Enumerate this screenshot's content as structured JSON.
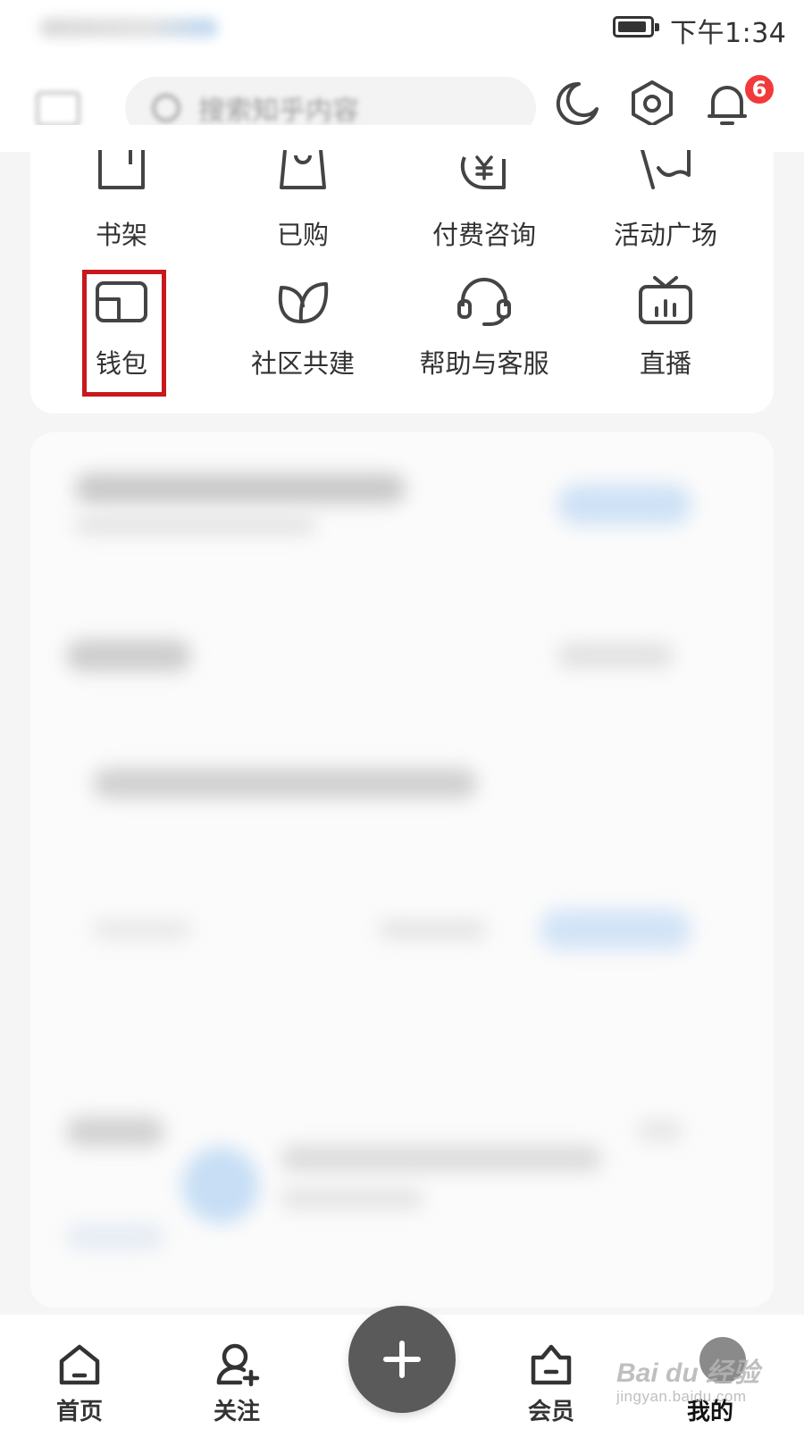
{
  "status_bar": {
    "time": "下午1:34"
  },
  "header": {
    "search_placeholder": "搜索知乎内容",
    "notification_count": "6"
  },
  "services": {
    "row1": [
      "书架",
      "已购",
      "付费咨询",
      "活动广场"
    ],
    "row2": [
      "钱包",
      "社区共建",
      "帮助与客服",
      "直播"
    ]
  },
  "bottom_nav": {
    "items": [
      "首页",
      "关注",
      "会员",
      "我的"
    ]
  },
  "watermark": {
    "main": "Bai du 经验",
    "sub": "jingyan.baidu.com"
  },
  "colors": {
    "highlight_border": "#c8181c",
    "badge": "#f23a3a",
    "fab": "#5a5a5a"
  }
}
